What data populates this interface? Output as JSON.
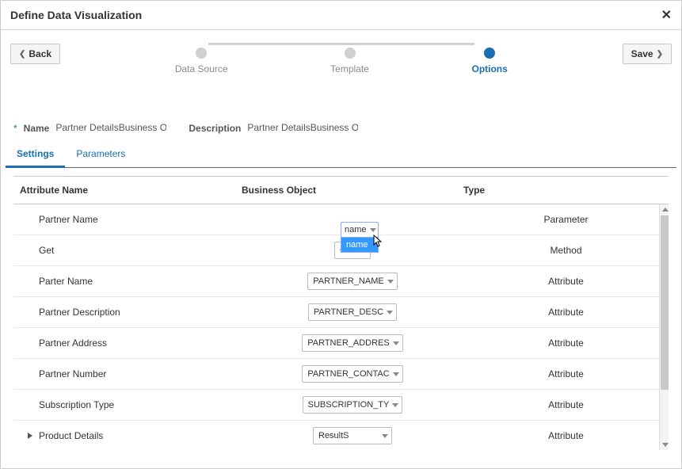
{
  "header": {
    "title": "Define Data Visualization",
    "close_glyph": "✕"
  },
  "toolbar": {
    "back_label": "Back",
    "save_label": "Save"
  },
  "stepper": {
    "step1": "Data Source",
    "step2": "Template",
    "step3": "Options"
  },
  "form": {
    "name_label": "Name",
    "name_value": "Partner DetailsBusiness Ob",
    "desc_label": "Description",
    "desc_value": "Partner DetailsBusiness Ob"
  },
  "tabs": {
    "settings": "Settings",
    "parameters": "Parameters"
  },
  "columns": {
    "attr": "Attribute Name",
    "bo": "Business Object",
    "type": "Type"
  },
  "dropdown": {
    "button_text": "name",
    "option_text": "name"
  },
  "rows": [
    {
      "attr": "Partner Name",
      "bo": "",
      "type": "Parameter",
      "expand": false,
      "small": true
    },
    {
      "attr": "Get",
      "bo": "GE",
      "type": "Method",
      "expand": false,
      "small": true
    },
    {
      "attr": "Parter Name",
      "bo": "PARTNER_NAME",
      "type": "Attribute",
      "expand": false,
      "small": false
    },
    {
      "attr": "Partner Description",
      "bo": "PARTNER_DESC",
      "type": "Attribute",
      "expand": false,
      "small": false
    },
    {
      "attr": "Partner Address",
      "bo": "PARTNER_ADDRES",
      "type": "Attribute",
      "expand": false,
      "small": false
    },
    {
      "attr": "Partner Number",
      "bo": "PARTNER_CONTAC",
      "type": "Attribute",
      "expand": false,
      "small": false
    },
    {
      "attr": "Subscription Type",
      "bo": "SUBSCRIPTION_TY",
      "type": "Attribute",
      "expand": false,
      "small": false
    },
    {
      "attr": "Product Details",
      "bo": "ResultS",
      "type": "Attribute",
      "expand": true,
      "small": false
    }
  ]
}
